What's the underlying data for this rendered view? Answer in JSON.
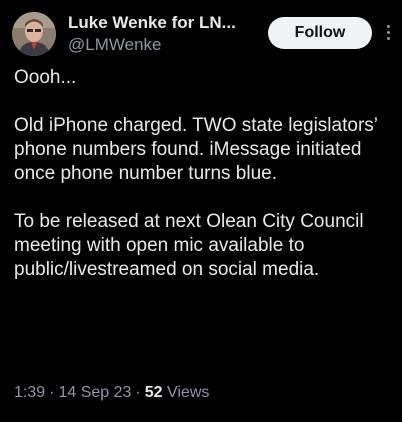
{
  "author": {
    "display_name": "Luke Wenke for LN...",
    "handle": "@LMWenke",
    "avatar_icon": "profile-photo"
  },
  "actions": {
    "follow_label": "Follow",
    "more_icon": "more-vertical-icon"
  },
  "tweet": {
    "paragraphs": [
      "Oooh...",
      "Old iPhone charged.  TWO state legislators’ phone numbers found.  iMessage initiated once phone number turns blue.",
      "To be released at next Olean City Council meeting with open mic available to public/livestreamed on social media."
    ],
    "time": "1:39",
    "date": "14 Sep 23",
    "separator": "·",
    "views_count": "52",
    "views_label": "Views"
  },
  "colors": {
    "background": "#000000",
    "text_primary": "#e7e9ea",
    "text_secondary": "#8b98a5",
    "follow_bg": "#eff3f4",
    "follow_text": "#0f1419"
  }
}
